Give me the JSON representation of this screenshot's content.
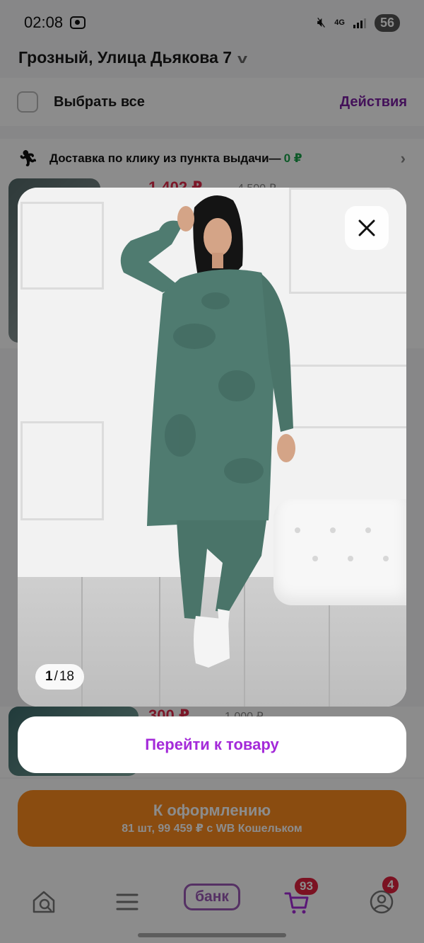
{
  "status": {
    "time": "02:08",
    "network": "4G",
    "battery": "56"
  },
  "header": {
    "address": "Грозный, Улица Дьякова 7"
  },
  "cart": {
    "select_all_label": "Выбрать все",
    "actions_label": "Действия",
    "delivery_text": "Доставка по клику из пункта выдачи—",
    "delivery_price": "0 ₽",
    "item1_price": "1 402 ₽",
    "item1_old_price": "4 500 ₽",
    "item2_price": "300 ₽",
    "item2_old_price": "1 000 ₽"
  },
  "checkout": {
    "title": "К оформлению",
    "subtitle": "81 шт, 99 459 ₽ с WB Кошельком"
  },
  "tabbar": {
    "bank_label": "банк",
    "cart_badge": "93",
    "profile_badge": "4"
  },
  "viewer": {
    "current_index": "1",
    "separator": "/",
    "total": "18",
    "goto_label": "Перейти к товару"
  },
  "colors": {
    "accent_purple": "#a42ad9",
    "checkout_orange": "#fc8a1e",
    "badge_red": "#e0213f",
    "outfit_green": "#4f7b70"
  }
}
